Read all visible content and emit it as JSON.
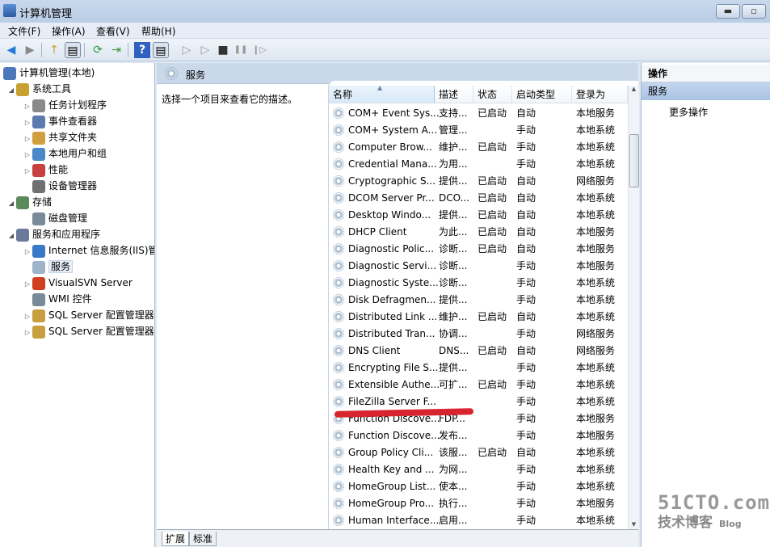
{
  "window": {
    "title": "计算机管理",
    "minimize": "▬",
    "maximize": "▫"
  },
  "menu": [
    "文件(F)",
    "操作(A)",
    "查看(V)",
    "帮助(H)"
  ],
  "toolbar": {
    "back": "◀",
    "forward": "▶",
    "up": "↑",
    "show_hide": "▤",
    "refresh": "⟳",
    "export": "⇥",
    "help": "?",
    "show_action": "▤",
    "start": "▷",
    "start2": "▷",
    "stop": "■",
    "pause": "❚❚",
    "resume": "❙▷"
  },
  "tree": {
    "root": "计算机管理(本地)",
    "items": [
      {
        "label": "系统工具",
        "level": 1,
        "expander": "◢"
      },
      {
        "label": "任务计划程序",
        "level": 2,
        "expander": "▷"
      },
      {
        "label": "事件查看器",
        "level": 2,
        "expander": "▷"
      },
      {
        "label": "共享文件夹",
        "level": 2,
        "expander": "▷"
      },
      {
        "label": "本地用户和组",
        "level": 2,
        "expander": "▷"
      },
      {
        "label": "性能",
        "level": 2,
        "expander": "▷"
      },
      {
        "label": "设备管理器",
        "level": 2,
        "expander": ""
      },
      {
        "label": "存储",
        "level": 1,
        "expander": "◢"
      },
      {
        "label": "磁盘管理",
        "level": 2,
        "expander": ""
      },
      {
        "label": "服务和应用程序",
        "level": 1,
        "expander": "◢"
      },
      {
        "label": "Internet 信息服务(IIS)管",
        "level": 2,
        "expander": "▷"
      },
      {
        "label": "服务",
        "level": 2,
        "expander": "",
        "selected": true
      },
      {
        "label": "VisualSVN Server",
        "level": 2,
        "expander": "▷"
      },
      {
        "label": "WMI 控件",
        "level": 2,
        "expander": ""
      },
      {
        "label": "SQL Server 配置管理器",
        "level": 2,
        "expander": "▷"
      },
      {
        "label": "SQL Server 配置管理器",
        "level": 2,
        "expander": "▷"
      }
    ]
  },
  "services": {
    "header": "服务",
    "description_prompt": "选择一个项目来查看它的描述。",
    "columns": [
      "名称",
      "描述",
      "状态",
      "启动类型",
      "登录为"
    ],
    "rows": [
      [
        "COM+ Event Sys...",
        "支持...",
        "已启动",
        "自动",
        "本地服务"
      ],
      [
        "COM+ System A...",
        "管理...",
        "",
        "手动",
        "本地系统"
      ],
      [
        "Computer Brow...",
        "维护...",
        "已启动",
        "手动",
        "本地系统"
      ],
      [
        "Credential Mana...",
        "为用...",
        "",
        "手动",
        "本地系统"
      ],
      [
        "Cryptographic S...",
        "提供...",
        "已启动",
        "自动",
        "网络服务"
      ],
      [
        "DCOM Server Pr...",
        "DCO...",
        "已启动",
        "自动",
        "本地系统"
      ],
      [
        "Desktop Windo...",
        "提供...",
        "已启动",
        "自动",
        "本地系统"
      ],
      [
        "DHCP Client",
        "为此...",
        "已启动",
        "自动",
        "本地服务"
      ],
      [
        "Diagnostic Polic...",
        "诊断...",
        "已启动",
        "自动",
        "本地服务"
      ],
      [
        "Diagnostic Servi...",
        "诊断...",
        "",
        "手动",
        "本地服务"
      ],
      [
        "Diagnostic Syste...",
        "诊断...",
        "",
        "手动",
        "本地系统"
      ],
      [
        "Disk Defragmen...",
        "提供...",
        "",
        "手动",
        "本地系统"
      ],
      [
        "Distributed Link ...",
        "维护...",
        "已启动",
        "自动",
        "本地系统"
      ],
      [
        "Distributed Tran...",
        "协调...",
        "",
        "手动",
        "网络服务"
      ],
      [
        "DNS Client",
        "DNS...",
        "已启动",
        "自动",
        "网络服务"
      ],
      [
        "Encrypting File S...",
        "提供...",
        "",
        "手动",
        "本地系统"
      ],
      [
        "Extensible Authe...",
        "可扩...",
        "已启动",
        "手动",
        "本地系统"
      ],
      [
        "FileZilla Server F...",
        "",
        "",
        "手动",
        "本地系统"
      ],
      [
        "Function Discove...",
        "FDP...",
        "",
        "手动",
        "本地服务"
      ],
      [
        "Function Discove...",
        "发布...",
        "",
        "手动",
        "本地服务"
      ],
      [
        "Group Policy Cli...",
        "该服...",
        "已启动",
        "自动",
        "本地系统"
      ],
      [
        "Health Key and ...",
        "为网...",
        "",
        "手动",
        "本地系统"
      ],
      [
        "HomeGroup List...",
        "使本...",
        "",
        "手动",
        "本地系统"
      ],
      [
        "HomeGroup Pro...",
        "执行...",
        "",
        "手动",
        "本地服务"
      ],
      [
        "Human Interface...",
        "启用...",
        "",
        "手动",
        "本地系统"
      ]
    ],
    "tabs": [
      "扩展",
      "标准"
    ]
  },
  "actions": {
    "header": "操作",
    "section": "服务",
    "more": "更多操作"
  },
  "watermark": {
    "site": "51CTO.com",
    "sub": "技术博客",
    "blog": "Blog"
  },
  "colors": {
    "annotation_red": "#d8242e",
    "selection": "#a9c3e4"
  }
}
